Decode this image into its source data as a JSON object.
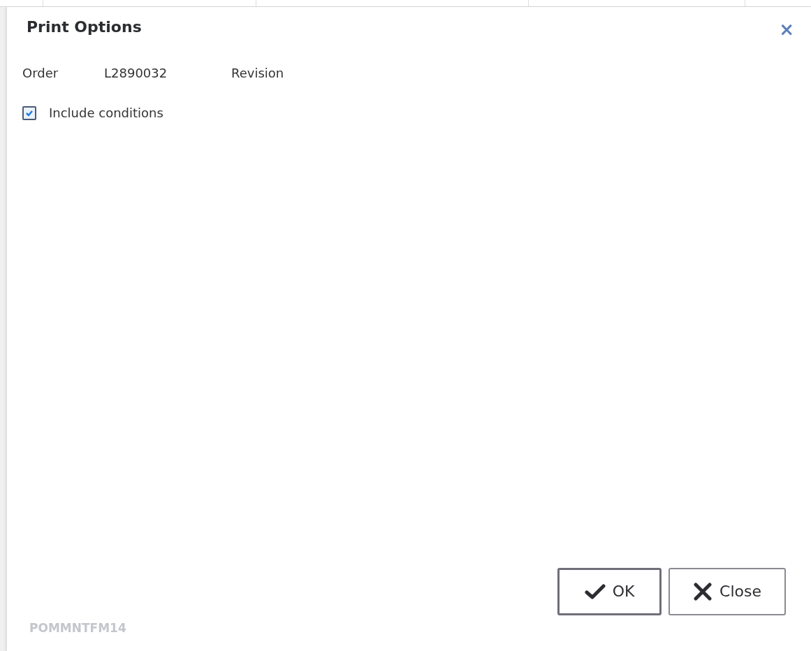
{
  "dialog": {
    "title": "Print Options",
    "close_icon": "×"
  },
  "fields": [
    {
      "label": "Order",
      "value": "L2890032"
    },
    {
      "label": "Revision"
    }
  ],
  "checkbox": {
    "label": "Include conditions",
    "checked": true
  },
  "buttons": [
    {
      "kind": "ok",
      "label": "OK",
      "default": true
    },
    {
      "kind": "close",
      "label": "Close",
      "default": false
    }
  ],
  "form_id": "POMMNTFM14"
}
